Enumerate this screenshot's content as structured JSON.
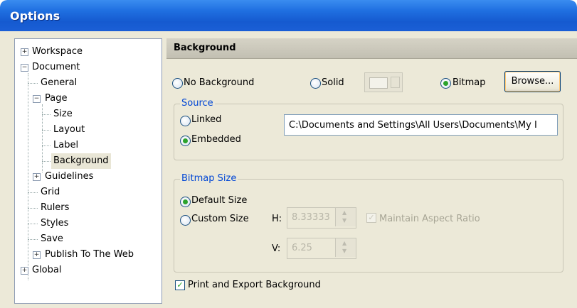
{
  "window": {
    "title": "Options"
  },
  "tree": {
    "items": [
      {
        "label": "Workspace",
        "expander": "+"
      },
      {
        "label": "Document",
        "expander": "−"
      },
      {
        "label": "General"
      },
      {
        "label": "Page",
        "expander": "−"
      },
      {
        "label": "Size"
      },
      {
        "label": "Layout"
      },
      {
        "label": "Label"
      },
      {
        "label": "Background",
        "selected": true
      },
      {
        "label": "Guidelines",
        "expander": "+"
      },
      {
        "label": "Grid"
      },
      {
        "label": "Rulers"
      },
      {
        "label": "Styles"
      },
      {
        "label": "Save"
      },
      {
        "label": "Publish To The Web",
        "expander": "+"
      },
      {
        "label": "Global",
        "expander": "+"
      }
    ]
  },
  "panel": {
    "header": "Background",
    "type_options": {
      "no_background": "No Background",
      "solid": "Solid",
      "bitmap": "Bitmap",
      "selected": "bitmap"
    },
    "browse_label": "Browse...",
    "source": {
      "title": "Source",
      "linked": "Linked",
      "embedded": "Embedded",
      "selected": "embedded",
      "path": "C:\\Documents and Settings\\All Users\\Documents\\My I"
    },
    "bitmap_size": {
      "title": "Bitmap Size",
      "default": "Default Size",
      "custom": "Custom Size",
      "selected": "default",
      "h_label": "H:",
      "h_value": "8.33333",
      "v_label": "V:",
      "v_value": "6.25",
      "maintain_label": "Maintain Aspect Ratio",
      "maintain_checked": true
    },
    "print_export": {
      "label": "Print and Export Background",
      "checked": true
    }
  }
}
